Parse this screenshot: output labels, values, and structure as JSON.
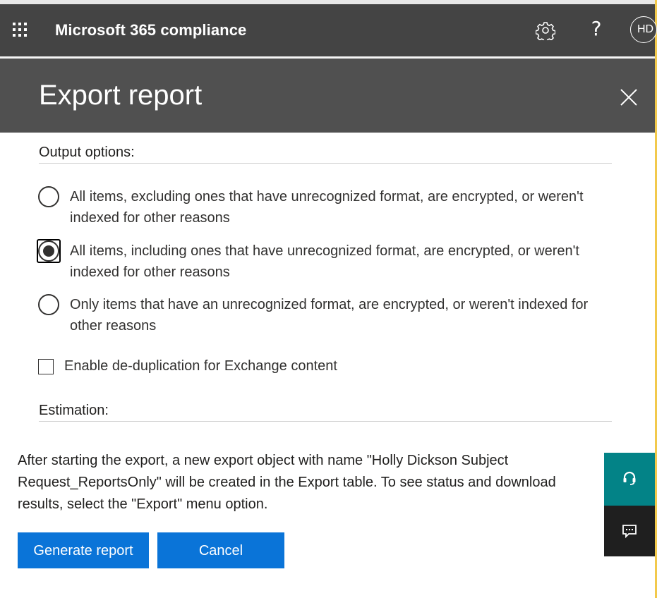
{
  "suite_bar": {
    "app_title": "Microsoft 365 compliance",
    "help_glyph": "?",
    "avatar_initials": "HD",
    "icons": [
      "waffle-icon",
      "gear-icon",
      "help-icon"
    ]
  },
  "panel": {
    "title": "Export report",
    "close_icon": "close-icon"
  },
  "output_options": {
    "label": "Output options:",
    "options": [
      {
        "label": "All items, excluding ones that have unrecognized format, are encrypted, or weren't indexed for other reasons",
        "selected": false
      },
      {
        "label": "All items, including ones that have unrecognized format, are encrypted, or weren't indexed for other reasons",
        "selected": true
      },
      {
        "label": "Only items that have an unrecognized format, are encrypted, or weren't indexed for other reasons",
        "selected": false
      }
    ]
  },
  "dedup": {
    "label": "Enable de-duplication for Exchange content",
    "checked": false
  },
  "estimation": {
    "label": "Estimation:"
  },
  "info": {
    "text": "After starting the export, a new export object with name \"Holly Dickson Subject Request_ReportsOnly\" will be created in the Export table. To see status and download results, select the \"Export\" menu option."
  },
  "buttons": {
    "generate": "Generate report",
    "cancel": "Cancel"
  },
  "floating": {
    "support_icon": "headset-icon",
    "feedback_icon": "feedback-icon"
  },
  "colors": {
    "suite_bar": "#444444",
    "panel_header": "#505050",
    "primary_button": "#0a74d8",
    "support_fab": "#038387",
    "feedback_fab": "#1f1f1f"
  }
}
